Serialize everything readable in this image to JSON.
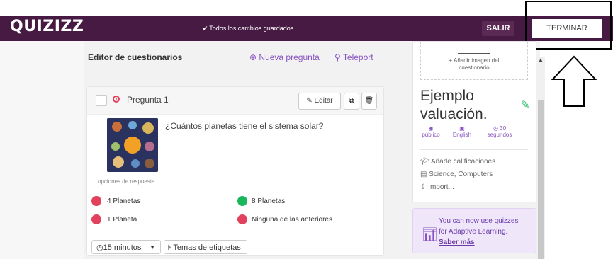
{
  "topbar": {
    "logo": "QUIZIZZ",
    "saved_status": "Todos los cambios guardados",
    "exit_label": "SALIR",
    "finish_label": "TERMINAR"
  },
  "editor": {
    "title": "Editor de cuestionarios",
    "new_question": "Nueva pregunta",
    "teleport": "Teleport"
  },
  "question": {
    "label": "Pregunta 1",
    "edit_label": "Editar",
    "text": "¿Cuántos planetas tiene el sistema solar?",
    "options_label": "opciones de respuesta",
    "options": [
      {
        "text": "4 Planetas",
        "correct": false
      },
      {
        "text": "8 Planetas",
        "correct": true
      },
      {
        "text": "1 Planeta",
        "correct": false
      },
      {
        "text": "Ninguna de las anteriores",
        "correct": false
      }
    ],
    "time": "15 minutos",
    "tags_label": "Temas de etiquetas"
  },
  "quiz_panel": {
    "add_image": "+ Añadir imagen del cuestionario",
    "title": "Ejemplo valuación.",
    "visibility": "público",
    "language": "English",
    "duration_value": "30",
    "duration_unit": "segundos",
    "grades": "Añade calificaciones",
    "subjects": "Science, Computers",
    "import": "Import..."
  },
  "adaptive": {
    "line1": "You can now use quizzes",
    "line2": "for Adaptive Learning.",
    "link": "Saber más"
  },
  "colors": {
    "topbar": "#461a42",
    "accent": "#8854c0",
    "wrong": "#e2415e",
    "correct": "#19b65a"
  }
}
